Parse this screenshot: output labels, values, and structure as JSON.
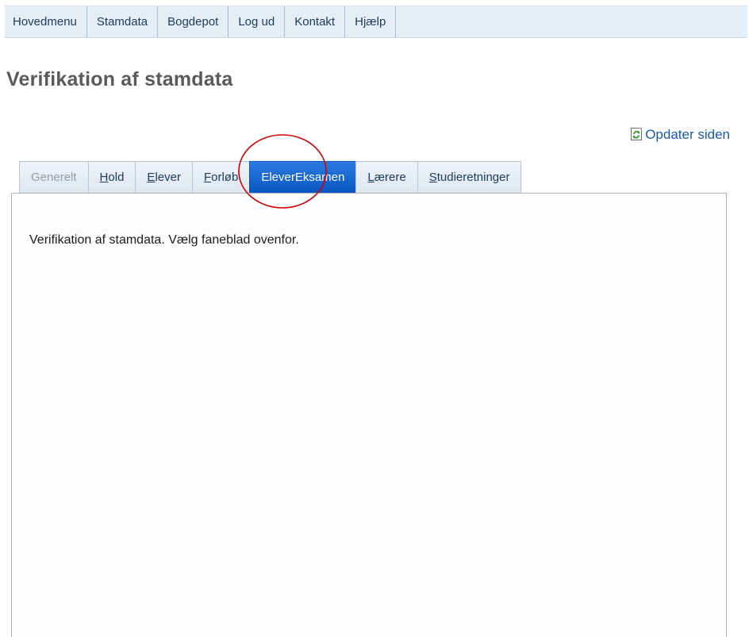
{
  "menu": {
    "items": [
      {
        "label": "Hovedmenu"
      },
      {
        "label": "Stamdata"
      },
      {
        "label": "Bogdepot"
      },
      {
        "label": "Log ud"
      },
      {
        "label": "Kontakt"
      },
      {
        "label": "Hjælp"
      }
    ]
  },
  "page": {
    "title": "Verifikation af stamdata"
  },
  "refresh": {
    "label": "Opdater siden",
    "icon": "refresh-icon"
  },
  "tabs": {
    "items": [
      {
        "label": "Generelt",
        "state": "disabled"
      },
      {
        "label": "Hold",
        "state": "normal"
      },
      {
        "label": "Elever",
        "state": "normal"
      },
      {
        "label": "Forløb",
        "state": "normal"
      },
      {
        "label": "EleverEksamen",
        "state": "active"
      },
      {
        "label": "Lærere",
        "state": "normal"
      },
      {
        "label": "Studieretninger",
        "state": "normal"
      }
    ]
  },
  "content": {
    "text": "Verifikation af stamdata. Vælg faneblad ovenfor."
  },
  "colors": {
    "active_tab": "#0b56c2",
    "link": "#1c58a8",
    "annotation": "#d40000"
  }
}
